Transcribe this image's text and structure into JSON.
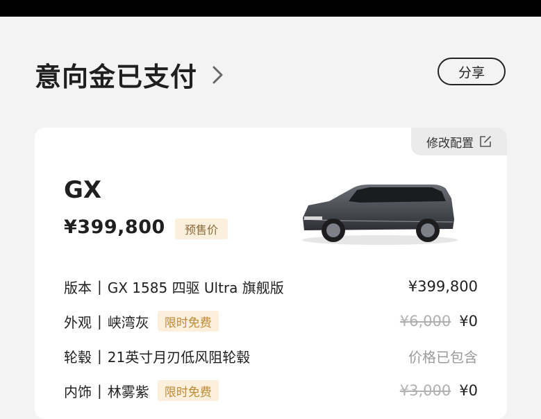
{
  "header": {
    "title": "意向金已支付",
    "share_label": "分享"
  },
  "card": {
    "modify_label": "修改配置",
    "model": "GX",
    "price": "¥399,800",
    "price_tag": "预售价",
    "rows": [
      {
        "label": "版本",
        "value": "GX 1585 四驱 Ultra 旗舰版",
        "promo": "",
        "original": "",
        "price": "¥399,800"
      },
      {
        "label": "外观",
        "value": "峡湾灰",
        "promo": "限时免费",
        "original": "¥6,000",
        "price": "¥0"
      },
      {
        "label": "轮毂",
        "value": "21英寸月刃低风阻轮毂",
        "promo": "",
        "original": "",
        "price": "价格已包含"
      },
      {
        "label": "内饰",
        "value": "林雾紫",
        "promo": "限时免费",
        "original": "¥3,000",
        "price": "¥0"
      }
    ]
  },
  "colors": {
    "promo_bg": "#fcefdc",
    "promo_text": "#c08a34",
    "background": "#f3f3f3"
  },
  "icons": [
    "chevron-right-icon",
    "edit-icon"
  ]
}
